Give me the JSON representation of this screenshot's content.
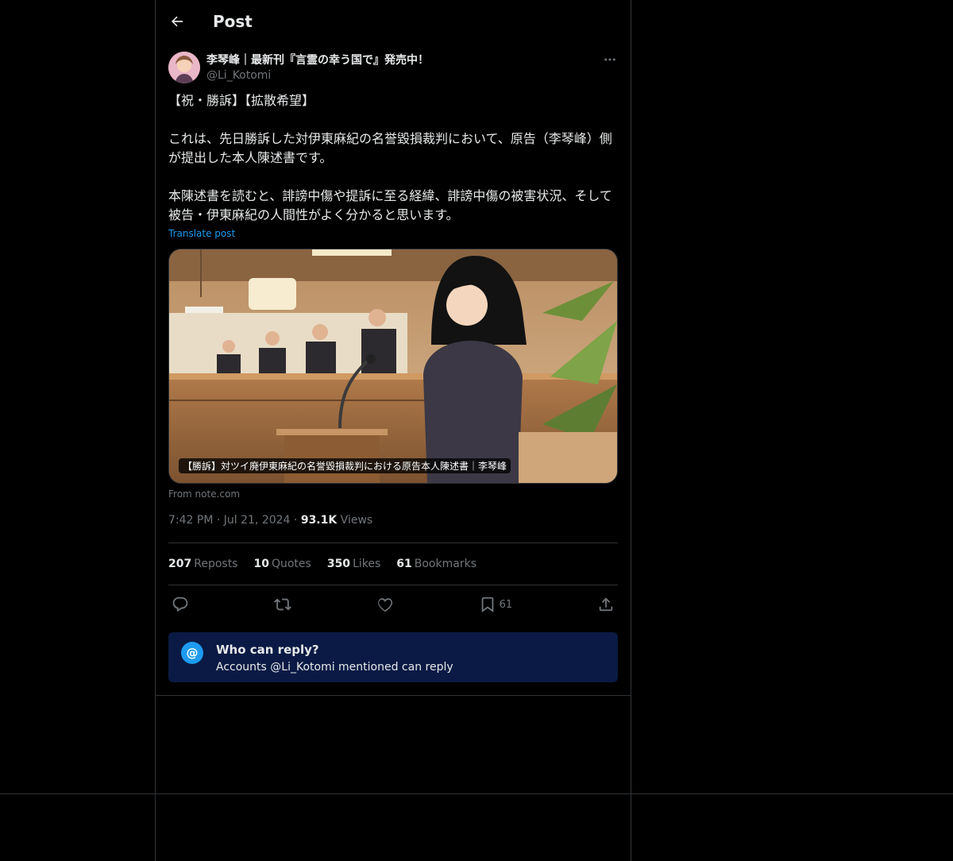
{
  "header": {
    "title": "Post"
  },
  "post": {
    "display_name": "李琴峰｜最新刊『言霊の幸う国で』発売中！",
    "handle": "@Li_Kotomi",
    "text": "【祝・勝訴】【拡散希望】\n\nこれは、先日勝訴した対伊東麻紀の名誉毀損裁判において、原告（李琴峰）側が提出した本人陳述書です。\n\n本陳述書を読むと、誹謗中傷や提訴に至る経緯、誹謗中傷の被害状況、そして被告・伊東麻紀の人間性がよく分かると思います。",
    "translate_label": "Translate post",
    "card": {
      "caption": "【勝訴】対ツイ廃伊東麻紀の名誉毀損裁判における原告本人陳述書｜李琴峰",
      "source": "From note.com"
    },
    "time": "7:42 PM",
    "date": "Jul 21, 2024",
    "views_count": "93.1K",
    "views_label": "Views",
    "stats": {
      "reposts_count": "207",
      "reposts_label": "Reposts",
      "quotes_count": "10",
      "quotes_label": "Quotes",
      "likes_count": "350",
      "likes_label": "Likes",
      "bookmarks_count": "61",
      "bookmarks_label": "Bookmarks"
    },
    "actions": {
      "bookmark_count": "61"
    },
    "who_can_reply": {
      "icon": "@",
      "title": "Who can reply?",
      "subtitle": "Accounts @Li_Kotomi mentioned can reply"
    }
  },
  "colors": {
    "accent": "#1d9bf0",
    "border": "#2f3336",
    "muted": "#71767b",
    "reply_box": "#0a1a44"
  }
}
